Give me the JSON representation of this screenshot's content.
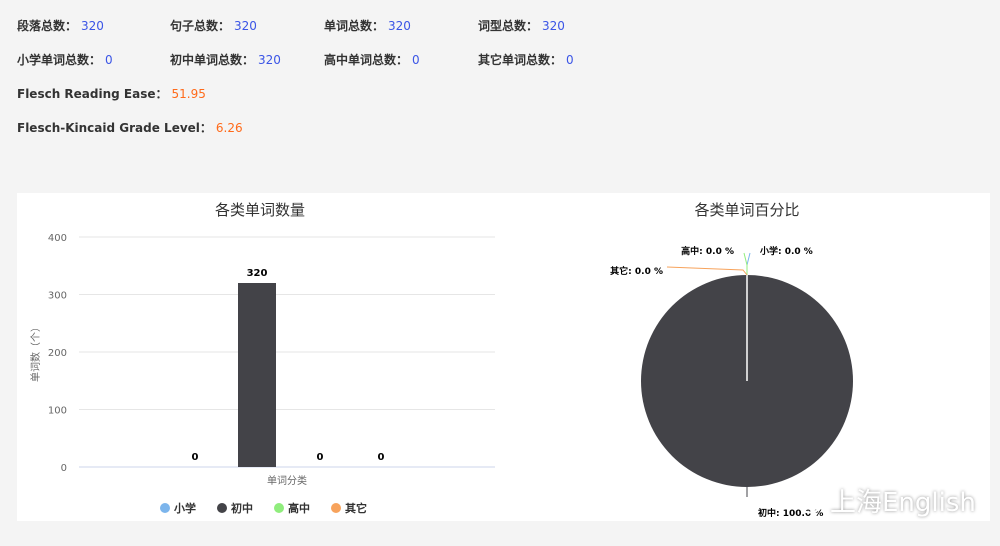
{
  "stats": {
    "row1": [
      {
        "label": "段落总数：",
        "value": "320"
      },
      {
        "label": "句子总数：",
        "value": "320"
      },
      {
        "label": "单词总数：",
        "value": "320"
      },
      {
        "label": "词型总数：",
        "value": "320"
      }
    ],
    "row2": [
      {
        "label": "小学单词总数：",
        "value": "0"
      },
      {
        "label": "初中单词总数：",
        "value": "320"
      },
      {
        "label": "高中单词总数：",
        "value": "0"
      },
      {
        "label": "其它单词总数：",
        "value": "0"
      }
    ],
    "flesch": {
      "label": "Flesch Reading Ease：",
      "value": "51.95"
    },
    "fk_grade": {
      "label": "Flesch-Kincaid Grade Level：",
      "value": "6.26"
    }
  },
  "colors": {
    "value_blue": "#3b55e6",
    "value_orange": "#ff6a1a",
    "xiaoxue": "#7cb5ec",
    "chuzhong": "#434348",
    "gaozhong": "#90ed7d",
    "qita": "#f7a35c"
  },
  "chart_data": [
    {
      "type": "bar",
      "title": "各类单词数量",
      "xlabel": "单词分类",
      "ylabel": "单词数（个）",
      "ylim": [
        0,
        400
      ],
      "yticks": [
        "0",
        "100",
        "200",
        "300",
        "400"
      ],
      "grid": true,
      "legend_position": "bottom",
      "series": [
        {
          "name": "小学",
          "values": [
            0
          ]
        },
        {
          "name": "初中",
          "values": [
            320
          ]
        },
        {
          "name": "高中",
          "values": [
            0
          ]
        },
        {
          "name": "其它",
          "values": [
            0
          ]
        }
      ],
      "data_labels": [
        "0",
        "320",
        "0",
        "0"
      ]
    },
    {
      "type": "pie",
      "title": "各类单词百分比",
      "slices": [
        {
          "name": "小学",
          "percent": 0.0,
          "label": "小学: 0.0 %"
        },
        {
          "name": "初中",
          "percent": 100.0,
          "label": "初中: 100.0 %"
        },
        {
          "name": "高中",
          "percent": 0.0,
          "label": "高中: 0.0 %"
        },
        {
          "name": "其它",
          "percent": 0.0,
          "label": "其它: 0.0 %"
        }
      ]
    }
  ],
  "watermark": {
    "text": "上海English"
  }
}
